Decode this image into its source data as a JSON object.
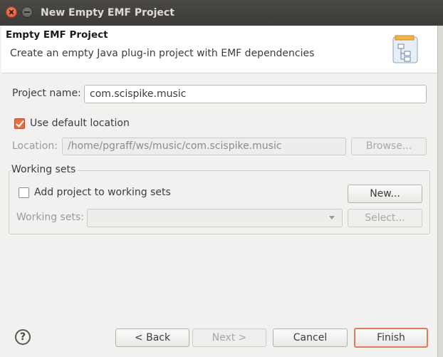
{
  "window": {
    "title": "New Empty EMF Project"
  },
  "header": {
    "title": "Empty EMF Project",
    "description": "Create an empty Java plug-in project with EMF dependencies",
    "icon": "project-wizard-icon"
  },
  "form": {
    "project_name_label": "Project name:",
    "project_name_value": "com.scispike.music",
    "use_default_location_label": "Use default location",
    "use_default_location_checked": true,
    "location_label": "Location:",
    "location_value": "/home/pgraff/ws/music/com.scispike.music",
    "browse_label": "Browse..."
  },
  "working_sets": {
    "group_label": "Working sets",
    "add_label": "Add project to working sets",
    "add_checked": false,
    "new_label": "New...",
    "working_sets_label": "Working sets:",
    "working_sets_value": "",
    "select_label": "Select..."
  },
  "footer": {
    "help_icon": "help-icon",
    "back_label": "< Back",
    "next_label": "Next >",
    "cancel_label": "Cancel",
    "finish_label": "Finish"
  },
  "colors": {
    "accent": "#df6f47",
    "titlebar": "#3c3b37"
  }
}
